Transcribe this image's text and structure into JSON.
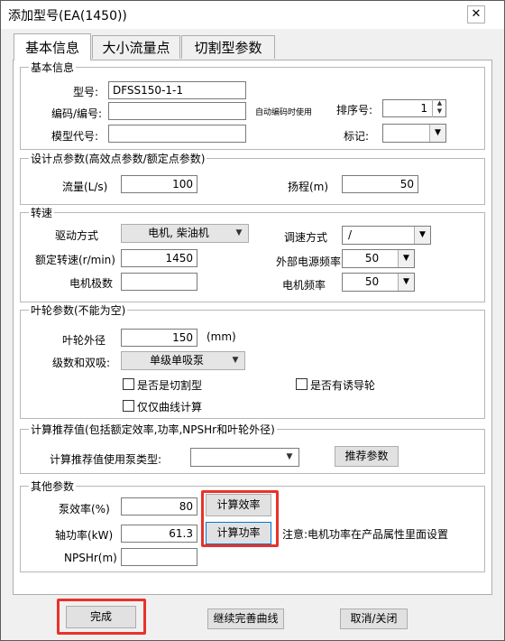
{
  "window": {
    "title": "添加型号(EA(1450))",
    "close_glyph": "✕"
  },
  "tabs": [
    {
      "label": "基本信息",
      "active": true
    },
    {
      "label": "大小流量点",
      "active": false
    },
    {
      "label": "切割型参数",
      "active": false
    }
  ],
  "basic_info": {
    "title": "基本信息",
    "model_label": "型号:",
    "model_value": "DFSS150-1-1",
    "code_label": "编码/编号:",
    "code_value": "",
    "auto_code_hint": "自动编码时使用",
    "order_label": "排序号:",
    "order_value": "1",
    "model_code_label": "模型代号:",
    "model_code_value": "",
    "mark_label": "标记:",
    "mark_value": ""
  },
  "design_point": {
    "title": "设计点参数(高效点参数/额定点参数)",
    "flow_label": "流量(L/s)",
    "flow_value": "100",
    "head_label": "扬程(m)",
    "head_value": "50"
  },
  "speed": {
    "title": "转速",
    "drive_label": "驱动方式",
    "drive_value": "电机, 柴油机",
    "regulate_label": "调速方式",
    "regulate_value": "/",
    "rated_speed_label": "额定转速(r/min)",
    "rated_speed_value": "1450",
    "ext_freq_label": "外部电源频率",
    "ext_freq_value": "50",
    "poles_label": "电机极数",
    "poles_value": "",
    "motor_freq_label": "电机频率",
    "motor_freq_value": "50"
  },
  "impeller": {
    "title": "叶轮参数(不能为空)",
    "diameter_label": "叶轮外径",
    "diameter_value": "150",
    "diameter_unit": "(mm)",
    "stage_label": "级数和双吸:",
    "stage_value": "单级单吸泵",
    "is_cut_label": "是否是切割型",
    "has_inducer_label": "是否有诱导轮",
    "curve_only_label": "仅仅曲线计算"
  },
  "recommend": {
    "title": "计算推荐值(包括额定效率,功率,NPSHr和叶轮外径)",
    "pump_type_label": "计算推荐值使用泵类型:",
    "pump_type_value": "",
    "recommend_button": "推荐参数"
  },
  "other": {
    "title": "其他参数",
    "efficiency_label": "泵效率(%)",
    "efficiency_value": "80",
    "calc_eff_button": "计算效率",
    "power_label": "轴功率(kW)",
    "power_value": "61.3",
    "calc_power_button": "计算功率",
    "power_note": "注意:电机功率在产品属性里面设置",
    "npshr_label": "NPSHr(m)",
    "npshr_value": ""
  },
  "footer": {
    "finish_button": "完成",
    "continue_button": "继续完善曲线",
    "cancel_button": "取消/关闭"
  },
  "colors": {
    "highlight": "#e8322b"
  }
}
